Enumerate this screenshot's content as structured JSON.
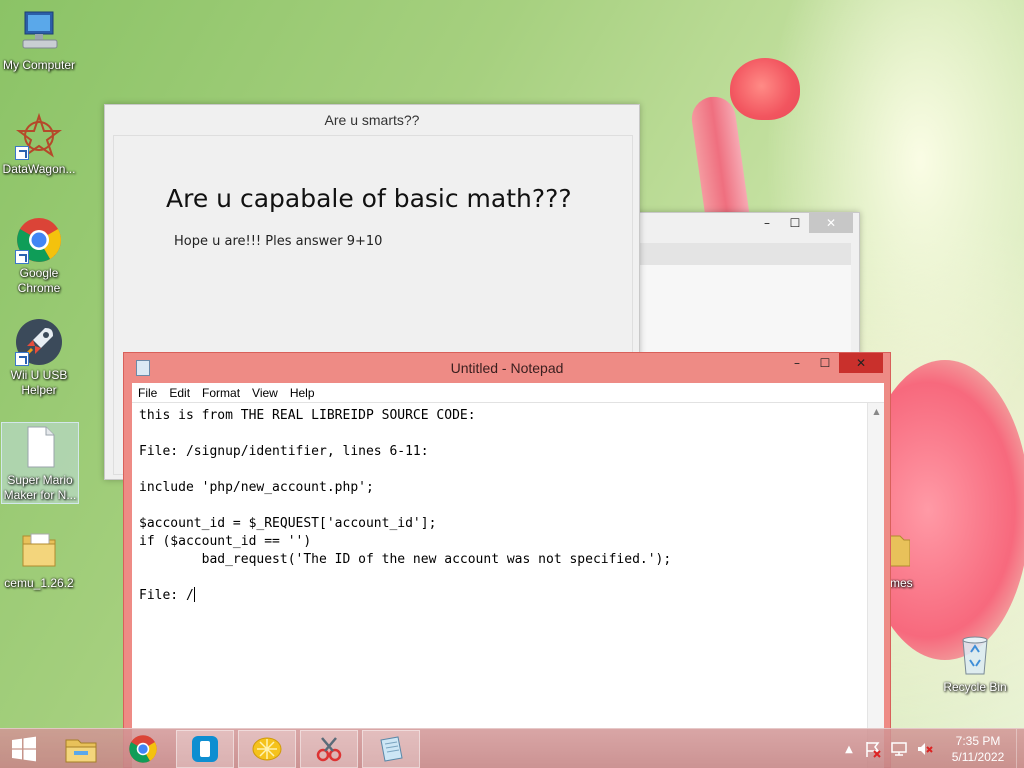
{
  "desktop": {
    "icons_left": [
      {
        "label": "My Computer",
        "icon": "computer-icon"
      },
      {
        "label": "DataWagon...",
        "icon": "datawagon-icon"
      },
      {
        "label": "Google Chrome",
        "icon": "chrome-icon"
      },
      {
        "label": "Wii U USB Helper",
        "icon": "rocket-icon"
      },
      {
        "label": "Super Mario Maker for N...",
        "icon": "file-icon"
      },
      {
        "label": "cemu_1.26.2",
        "icon": "folder-icon"
      }
    ],
    "icons_right": [
      {
        "label": "mes",
        "icon": "folder-icon"
      },
      {
        "label": "Recycle Bin",
        "icon": "recycle-bin-icon"
      }
    ]
  },
  "quiz_window": {
    "title": "Are u smarts??",
    "heading": "Are u capabale of basic math???",
    "prompt": "Hope u are!!! Ples answer 9+10"
  },
  "background_window": {
    "minimize": "–",
    "maximize": "☐",
    "close": "✕"
  },
  "notepad": {
    "title": "Untitled - Notepad",
    "minimize": "–",
    "maximize": "☐",
    "close": "✕",
    "menu": [
      "File",
      "Edit",
      "Format",
      "View",
      "Help"
    ],
    "content": "this is from THE REAL LIBREIDP SOURCE CODE:\n\nFile: /signup/identifier, lines 6-11:\n\ninclude 'php/new_account.php';\n\n$account_id = $_REQUEST['account_id'];\nif ($account_id == '')\n        bad_request('The ID of the new account was not specified.');\n\nFile: /"
  },
  "taskbar": {
    "apps": [
      "file-explorer-icon",
      "chrome-icon",
      "wii-u-icon",
      "lemon-icon",
      "scissors-icon",
      "notepad-icon"
    ],
    "active_app": "notepad-icon",
    "tray_icons": [
      "chevron-up-icon",
      "action-center-flag-icon",
      "network-icon",
      "volume-muted-icon"
    ],
    "time": "7:35 PM",
    "date": "5/11/2022"
  },
  "colors": {
    "notepad_frame": "#ee8b85",
    "close_red": "#c9302c"
  }
}
